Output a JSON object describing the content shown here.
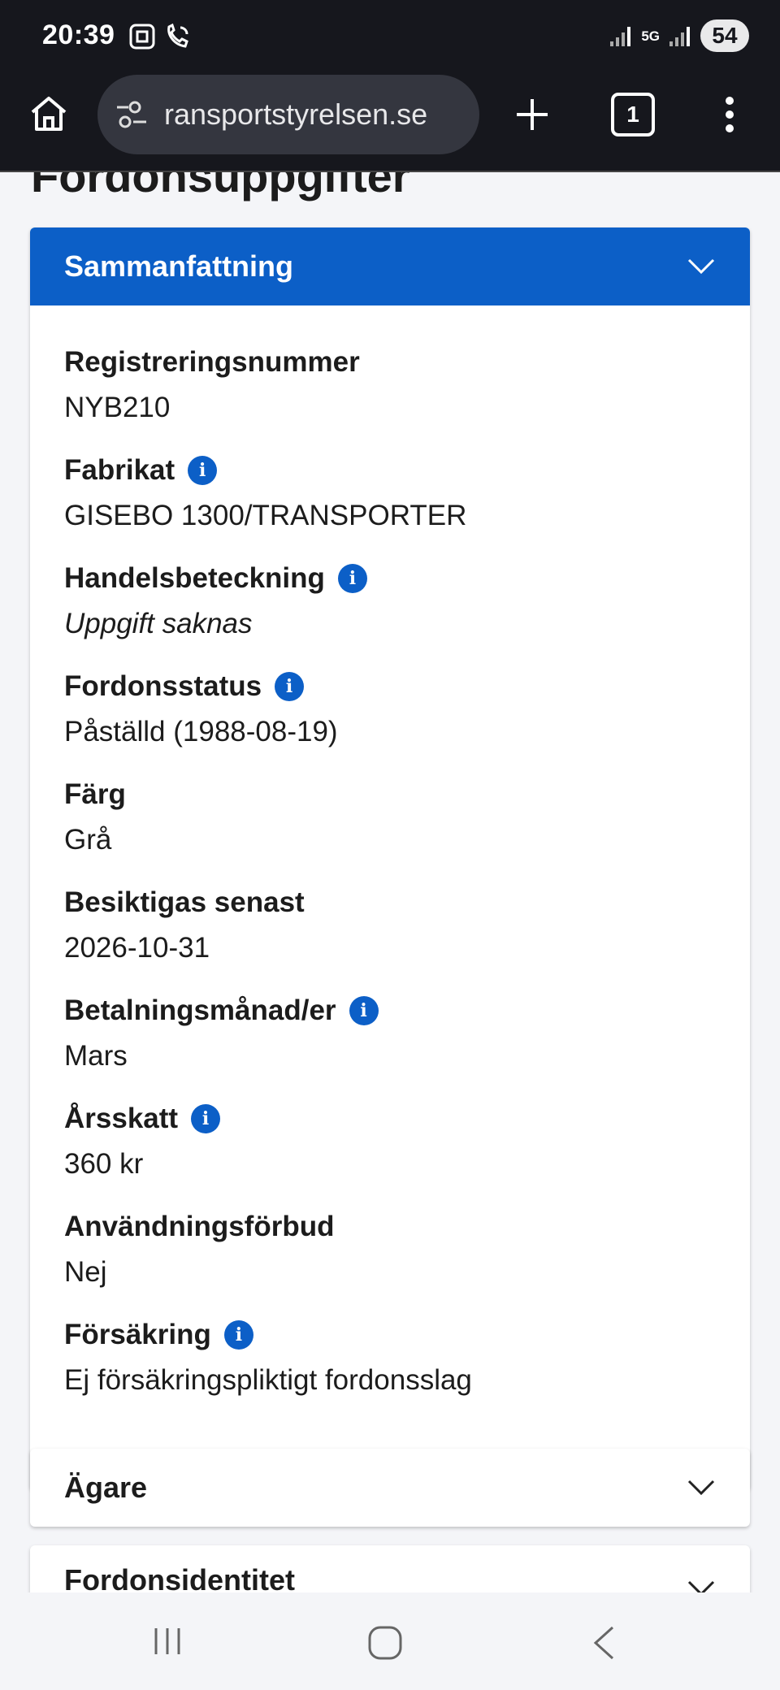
{
  "status_bar": {
    "time": "20:39",
    "network_label": "5G",
    "battery": "54"
  },
  "browser": {
    "url": "ransportstyrelsen.se",
    "tab_count": "1"
  },
  "page": {
    "title": "Fordonsuppgifter"
  },
  "summary": {
    "title": "Sammanfattning",
    "header_color": "#0c5fc7",
    "fields": [
      {
        "label": "Registreringsnummer",
        "value": "NYB210",
        "info": false
      },
      {
        "label": "Fabrikat",
        "value": "GISEBO 1300/TRANSPORTER",
        "info": true
      },
      {
        "label": "Handelsbeteckning",
        "value": "Uppgift saknas",
        "info": true
      },
      {
        "label": "Fordonsstatus",
        "value": "Påställd (1988-08-19)",
        "info": true
      },
      {
        "label": "Färg",
        "value": "Grå",
        "info": false
      },
      {
        "label": "Besiktigas senast",
        "value": "2026-10-31",
        "info": false
      },
      {
        "label": "Betalningsmånad/er",
        "value": "Mars",
        "info": true
      },
      {
        "label": "Årsskatt",
        "value": "360 kr",
        "info": true
      },
      {
        "label": "Användningsförbud",
        "value": "Nej",
        "info": false
      },
      {
        "label": "Försäkring",
        "value": "Ej försäkringspliktigt fordonsslag",
        "info": true
      }
    ]
  },
  "sections": {
    "owner": "Ägare",
    "identity": "Fordonsidentitet"
  },
  "icons": {
    "info": "i"
  }
}
